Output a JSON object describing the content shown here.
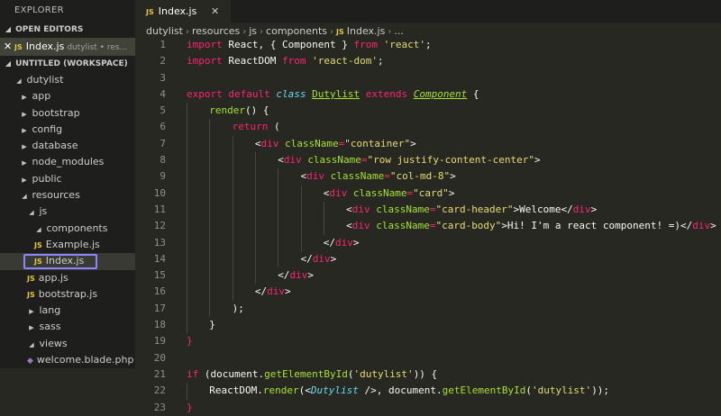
{
  "explorer": {
    "title": "EXPLORER",
    "open_editors": {
      "label": "OPEN EDITORS",
      "item": {
        "name": "Index.js",
        "desc": "dutylist • res...",
        "close": "✕",
        "badge": "JS"
      }
    },
    "workspace": {
      "label": "UNTITLED (WORKSPACE)",
      "tree": [
        {
          "label": "dutylist",
          "indent": 16,
          "caret": "◢",
          "type": "folder"
        },
        {
          "label": "app",
          "indent": 22,
          "caret": "▶",
          "type": "folder"
        },
        {
          "label": "bootstrap",
          "indent": 22,
          "caret": "▶",
          "type": "folder"
        },
        {
          "label": "config",
          "indent": 22,
          "caret": "▶",
          "type": "folder"
        },
        {
          "label": "database",
          "indent": 22,
          "caret": "▶",
          "type": "folder"
        },
        {
          "label": "node_modules",
          "indent": 22,
          "caret": "▶",
          "type": "folder"
        },
        {
          "label": "public",
          "indent": 22,
          "caret": "▶",
          "type": "folder"
        },
        {
          "label": "resources",
          "indent": 22,
          "caret": "◢",
          "type": "folder"
        },
        {
          "label": "js",
          "indent": 30,
          "caret": "◢",
          "type": "folder"
        },
        {
          "label": "components",
          "indent": 38,
          "caret": "◢",
          "type": "folder"
        },
        {
          "label": "Example.js",
          "indent": 38,
          "type": "js"
        },
        {
          "label": "Index.js",
          "indent": 38,
          "type": "js",
          "selected": true
        },
        {
          "label": "app.js",
          "indent": 30,
          "type": "js"
        },
        {
          "label": "bootstrap.js",
          "indent": 30,
          "type": "js"
        },
        {
          "label": "lang",
          "indent": 30,
          "caret": "▶",
          "type": "folder"
        },
        {
          "label": "sass",
          "indent": 30,
          "caret": "▶",
          "type": "folder"
        },
        {
          "label": "views",
          "indent": 30,
          "caret": "◢",
          "type": "folder"
        },
        {
          "label": "welcome.blade.php",
          "indent": 30,
          "type": "blade"
        }
      ]
    }
  },
  "tab": {
    "label": "Index.js",
    "badge": "JS",
    "close": "✕"
  },
  "breadcrumb": {
    "parts": [
      "dutylist",
      "resources",
      "js",
      "components"
    ],
    "file": "Index.js",
    "file_badge": "JS",
    "separator": "›",
    "more": "..."
  },
  "colors": {
    "keyword": "#f92672",
    "string": "#e6db74",
    "attribute": "#a6e22e",
    "type": "#66d9ef",
    "selection_border": "#8a86ff"
  },
  "code": {
    "lines": [
      {
        "n": "1",
        "indent": 0,
        "tokens": [
          [
            "kw",
            "import"
          ],
          [
            "p",
            " React, { Component } "
          ],
          [
            "kw",
            "from"
          ],
          [
            "p",
            " "
          ],
          [
            "str",
            "'react'"
          ],
          [
            "p",
            ";"
          ]
        ]
      },
      {
        "n": "2",
        "indent": 0,
        "tokens": [
          [
            "kw",
            "import"
          ],
          [
            "p",
            " ReactDOM "
          ],
          [
            "kw",
            "from"
          ],
          [
            "p",
            " "
          ],
          [
            "str",
            "'react-dom'"
          ],
          [
            "p",
            ";"
          ]
        ]
      },
      {
        "n": "3",
        "indent": 0,
        "tokens": []
      },
      {
        "n": "4",
        "indent": 0,
        "tokens": [
          [
            "kw",
            "export"
          ],
          [
            "p",
            " "
          ],
          [
            "kw",
            "default"
          ],
          [
            "p",
            " "
          ],
          [
            "it",
            "class"
          ],
          [
            "p",
            " "
          ],
          [
            "cls",
            "Dutylist"
          ],
          [
            "p",
            " "
          ],
          [
            "kw",
            "extends"
          ],
          [
            "p",
            " "
          ],
          [
            "inh",
            "Component"
          ],
          [
            "p",
            " {"
          ]
        ]
      },
      {
        "n": "5",
        "indent": 1,
        "tokens": [
          [
            "fn",
            "render"
          ],
          [
            "p",
            "() {"
          ]
        ]
      },
      {
        "n": "6",
        "indent": 2,
        "tokens": [
          [
            "kw",
            "return"
          ],
          [
            "p",
            " ("
          ]
        ]
      },
      {
        "n": "7",
        "indent": 3,
        "tokens": [
          [
            "p",
            "<"
          ],
          [
            "kw",
            "div"
          ],
          [
            "p",
            " "
          ],
          [
            "attr",
            "className"
          ],
          [
            "kw",
            "="
          ],
          [
            "str",
            "\"container\""
          ],
          [
            "p",
            ">"
          ]
        ]
      },
      {
        "n": "8",
        "indent": 4,
        "tokens": [
          [
            "p",
            "<"
          ],
          [
            "kw",
            "div"
          ],
          [
            "p",
            " "
          ],
          [
            "attr",
            "className"
          ],
          [
            "kw",
            "="
          ],
          [
            "str",
            "\"row justify-content-center\""
          ],
          [
            "p",
            ">"
          ]
        ]
      },
      {
        "n": "9",
        "indent": 5,
        "tokens": [
          [
            "p",
            "<"
          ],
          [
            "kw",
            "div"
          ],
          [
            "p",
            " "
          ],
          [
            "attr",
            "className"
          ],
          [
            "kw",
            "="
          ],
          [
            "str",
            "\"col-md-8\""
          ],
          [
            "p",
            ">"
          ]
        ]
      },
      {
        "n": "10",
        "indent": 6,
        "tokens": [
          [
            "p",
            "<"
          ],
          [
            "kw",
            "div"
          ],
          [
            "p",
            " "
          ],
          [
            "attr",
            "className"
          ],
          [
            "kw",
            "="
          ],
          [
            "str",
            "\"card\""
          ],
          [
            "p",
            ">"
          ]
        ]
      },
      {
        "n": "11",
        "indent": 7,
        "tokens": [
          [
            "p",
            "<"
          ],
          [
            "kw",
            "div"
          ],
          [
            "p",
            " "
          ],
          [
            "attr",
            "className"
          ],
          [
            "kw",
            "="
          ],
          [
            "str",
            "\"card-header\""
          ],
          [
            "p",
            ">Welcome</"
          ],
          [
            "kw",
            "div"
          ],
          [
            "p",
            ">"
          ]
        ]
      },
      {
        "n": "12",
        "indent": 7,
        "tokens": [
          [
            "p",
            "<"
          ],
          [
            "kw",
            "div"
          ],
          [
            "p",
            " "
          ],
          [
            "attr",
            "className"
          ],
          [
            "kw",
            "="
          ],
          [
            "str",
            "\"card-body\""
          ],
          [
            "p",
            ">Hi! I'm a react component! =)</"
          ],
          [
            "kw",
            "div"
          ],
          [
            "p",
            ">"
          ]
        ]
      },
      {
        "n": "13",
        "indent": 6,
        "tokens": [
          [
            "p",
            "</"
          ],
          [
            "kw",
            "div"
          ],
          [
            "p",
            ">"
          ]
        ]
      },
      {
        "n": "14",
        "indent": 5,
        "tokens": [
          [
            "p",
            "</"
          ],
          [
            "kw",
            "div"
          ],
          [
            "p",
            ">"
          ]
        ]
      },
      {
        "n": "15",
        "indent": 4,
        "tokens": [
          [
            "p",
            "</"
          ],
          [
            "kw",
            "div"
          ],
          [
            "p",
            ">"
          ]
        ]
      },
      {
        "n": "16",
        "indent": 3,
        "tokens": [
          [
            "p",
            "</"
          ],
          [
            "kw",
            "div"
          ],
          [
            "p",
            ">"
          ]
        ]
      },
      {
        "n": "17",
        "indent": 2,
        "tokens": [
          [
            "p",
            ");"
          ]
        ]
      },
      {
        "n": "18",
        "indent": 1,
        "tokens": [
          [
            "p",
            "}"
          ]
        ]
      },
      {
        "n": "19",
        "indent": 0,
        "tokens": [
          [
            "kw",
            "}"
          ]
        ]
      },
      {
        "n": "20",
        "indent": 0,
        "tokens": []
      },
      {
        "n": "21",
        "indent": 0,
        "tokens": [
          [
            "kw",
            "if"
          ],
          [
            "p",
            " (document."
          ],
          [
            "fn",
            "getElementById"
          ],
          [
            "p",
            "("
          ],
          [
            "str",
            "'dutylist'"
          ],
          [
            "p",
            ")) {"
          ]
        ]
      },
      {
        "n": "22",
        "indent": 1,
        "tokens": [
          [
            "p",
            "ReactDOM."
          ],
          [
            "fn",
            "render"
          ],
          [
            "p",
            "(<"
          ],
          [
            "itag",
            "Dutylist"
          ],
          [
            "p",
            " />, document."
          ],
          [
            "fn",
            "getElementById"
          ],
          [
            "p",
            "("
          ],
          [
            "str",
            "'dutylist'"
          ],
          [
            "p",
            "));"
          ]
        ]
      },
      {
        "n": "23",
        "indent": 0,
        "tokens": [
          [
            "kw",
            "}"
          ]
        ]
      }
    ]
  }
}
